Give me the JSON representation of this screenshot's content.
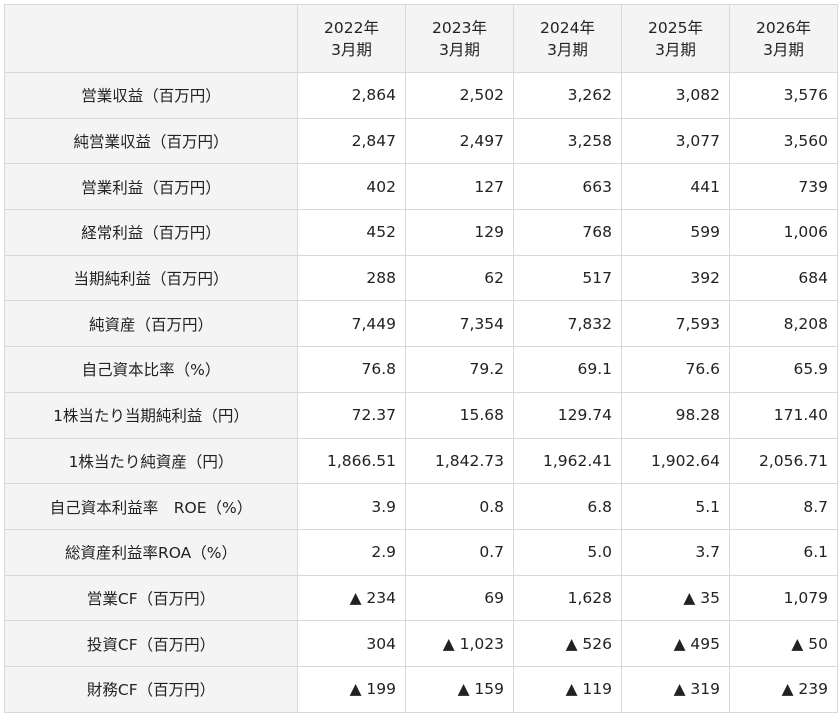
{
  "columns": [
    {
      "line1": "2022年",
      "line2": "3月期"
    },
    {
      "line1": "2023年",
      "line2": "3月期"
    },
    {
      "line1": "2024年",
      "line2": "3月期"
    },
    {
      "line1": "2025年",
      "line2": "3月期"
    },
    {
      "line1": "2026年",
      "line2": "3月期"
    }
  ],
  "rows": [
    {
      "label": "営業収益（百万円）",
      "values": [
        "2,864",
        "2,502",
        "3,262",
        "3,082",
        "3,576"
      ]
    },
    {
      "label": "純営業収益（百万円）",
      "values": [
        "2,847",
        "2,497",
        "3,258",
        "3,077",
        "3,560"
      ]
    },
    {
      "label": "営業利益（百万円）",
      "values": [
        "402",
        "127",
        "663",
        "441",
        "739"
      ]
    },
    {
      "label": "経常利益（百万円）",
      "values": [
        "452",
        "129",
        "768",
        "599",
        "1,006"
      ]
    },
    {
      "label": "当期純利益（百万円）",
      "values": [
        "288",
        "62",
        "517",
        "392",
        "684"
      ]
    },
    {
      "label": "純資産（百万円）",
      "values": [
        "7,449",
        "7,354",
        "7,832",
        "7,593",
        "8,208"
      ]
    },
    {
      "label": "自己資本比率（%）",
      "values": [
        "76.8",
        "79.2",
        "69.1",
        "76.6",
        "65.9"
      ]
    },
    {
      "label": "1株当たり当期純利益（円）",
      "values": [
        "72.37",
        "15.68",
        "129.74",
        "98.28",
        "171.40"
      ]
    },
    {
      "label": "1株当たり純資産（円）",
      "values": [
        "1,866.51",
        "1,842.73",
        "1,962.41",
        "1,902.64",
        "2,056.71"
      ]
    },
    {
      "label": "自己資本利益率　ROE（%）",
      "values": [
        "3.9",
        "0.8",
        "6.8",
        "5.1",
        "8.7"
      ]
    },
    {
      "label": "総資産利益率ROA（%）",
      "values": [
        "2.9",
        "0.7",
        "5.0",
        "3.7",
        "6.1"
      ]
    },
    {
      "label": "営業CF（百万円）",
      "values": [
        "▲ 234",
        "69",
        "1,628",
        "▲ 35",
        "1,079"
      ]
    },
    {
      "label": "投資CF（百万円）",
      "values": [
        "304",
        "▲ 1,023",
        "▲ 526",
        "▲ 495",
        "▲ 50"
      ]
    },
    {
      "label": "財務CF（百万円）",
      "values": [
        "▲ 199",
        "▲ 159",
        "▲ 119",
        "▲ 319",
        "▲ 239"
      ]
    }
  ]
}
